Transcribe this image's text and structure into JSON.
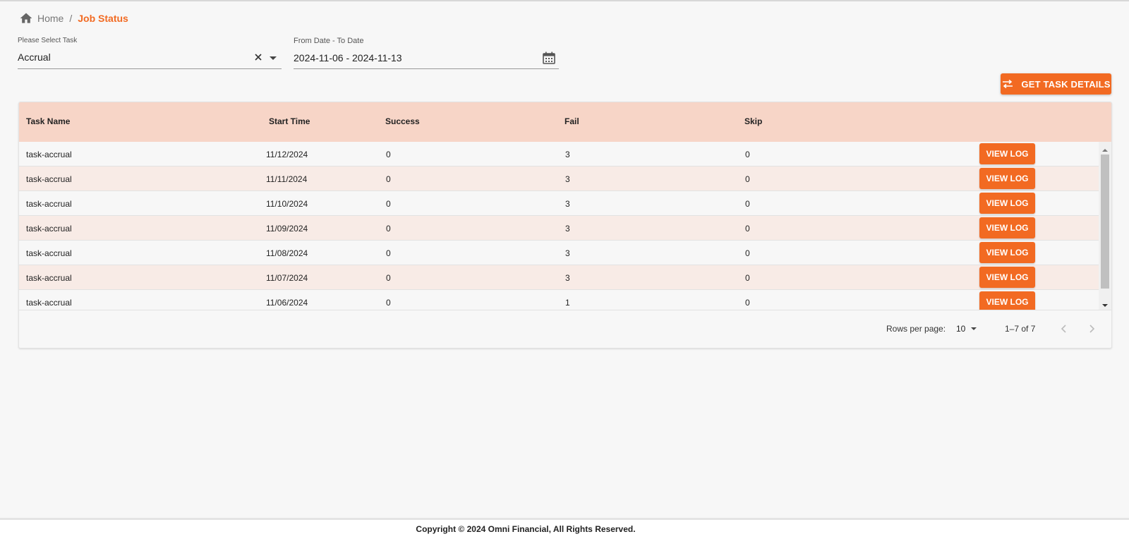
{
  "breadcrumb": {
    "home_label": "Home",
    "separator": "/",
    "current_label": "Job Status",
    "icon": "home-icon"
  },
  "filters": {
    "task": {
      "label": "Please Select Task",
      "value": "Accrual",
      "icons": [
        "close-icon",
        "chevron-down-icon"
      ]
    },
    "date_range": {
      "label": "From Date - To Date",
      "value": "2024-11-06 - 2024-11-13",
      "icon": "calendar-icon"
    }
  },
  "actions": {
    "get_task_details_label": "GET TASK DETAILS",
    "icon": "swap-arrows-icon"
  },
  "table": {
    "columns": [
      "Task Name",
      "Start Time",
      "Success",
      "Fail",
      "Skip"
    ],
    "view_log_label": "VIEW LOG",
    "rows": [
      {
        "task_name": "task-accrual",
        "start_time": "11/12/2024",
        "success": "0",
        "fail": "3",
        "skip": "0"
      },
      {
        "task_name": "task-accrual",
        "start_time": "11/11/2024",
        "success": "0",
        "fail": "3",
        "skip": "0"
      },
      {
        "task_name": "task-accrual",
        "start_time": "11/10/2024",
        "success": "0",
        "fail": "3",
        "skip": "0"
      },
      {
        "task_name": "task-accrual",
        "start_time": "11/09/2024",
        "success": "0",
        "fail": "3",
        "skip": "0"
      },
      {
        "task_name": "task-accrual",
        "start_time": "11/08/2024",
        "success": "0",
        "fail": "3",
        "skip": "0"
      },
      {
        "task_name": "task-accrual",
        "start_time": "11/07/2024",
        "success": "0",
        "fail": "3",
        "skip": "0"
      },
      {
        "task_name": "task-accrual",
        "start_time": "11/06/2024",
        "success": "0",
        "fail": "1",
        "skip": "0"
      }
    ]
  },
  "pagination": {
    "rows_per_page_label": "Rows per page:",
    "rows_per_page_value": "10",
    "range_text": "1–7 of 7"
  },
  "footer": {
    "copyright": "Copyright © 2024 Omni Financial, All Rights Reserved."
  },
  "colors": {
    "accent": "#f26a22",
    "header_bg": "#f7d5c7",
    "alt_row_bg": "#f8ebe6",
    "page_bg": "#f7f7f7"
  }
}
